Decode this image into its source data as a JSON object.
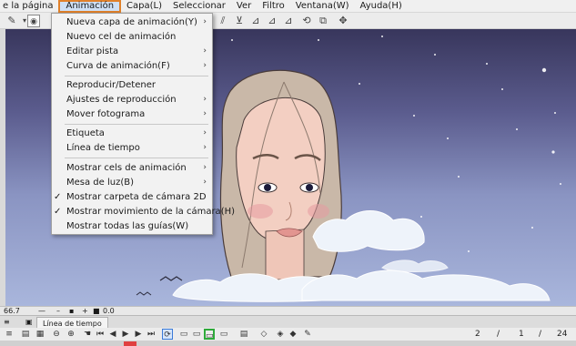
{
  "menubar": {
    "items": [
      {
        "label": "e la página"
      },
      {
        "label": "Animación"
      },
      {
        "label": "Capa(L)"
      },
      {
        "label": "Seleccionar"
      },
      {
        "label": "Ver"
      },
      {
        "label": "Filtro"
      },
      {
        "label": "Ventana(W)"
      },
      {
        "label": "Ayuda(H)"
      }
    ],
    "active_index": 1
  },
  "dropdown": {
    "items": [
      {
        "label": "Nueva capa de animación(Y)",
        "submenu": true
      },
      {
        "label": "Nuevo cel de animación"
      },
      {
        "label": "Editar pista",
        "submenu": true
      },
      {
        "label": "Curva de animación(F)",
        "submenu": true
      },
      {
        "label": "Reproducir/Detener"
      },
      {
        "label": "Ajustes de reproducción",
        "submenu": true
      },
      {
        "label": "Mover fotograma",
        "submenu": true
      },
      {
        "label": "Etiqueta",
        "submenu": true
      },
      {
        "label": "Línea de tiempo",
        "submenu": true
      },
      {
        "label": "Mostrar cels de animación",
        "submenu": true
      },
      {
        "label": "Mesa de luz(B)",
        "submenu": true
      },
      {
        "label": "Mostrar carpeta de cámara 2D",
        "checked": true
      },
      {
        "label": "Mostrar movimiento de la cámara(H)",
        "checked": true
      },
      {
        "label": "Mostrar todas las guías(W)"
      }
    ],
    "arrow_glyph": "›",
    "check_glyph": "✓"
  },
  "statusbar": {
    "zoom": "66.7",
    "rotation": "0.0"
  },
  "timeline": {
    "tab_label": "Línea de tiempo",
    "current_frame": "2",
    "start_frame": "1",
    "end_frame": "24"
  },
  "colors": {
    "menu_highlight": "#e0802a",
    "sky_top": "#38365c",
    "sky_bottom": "#a9b6dc",
    "skin": "#f3cfc2",
    "hair": "#c9b8a8",
    "cloud": "#eef3fa",
    "loop_button": "#3a7ad8",
    "green_highlight": "#2eaa3a"
  }
}
